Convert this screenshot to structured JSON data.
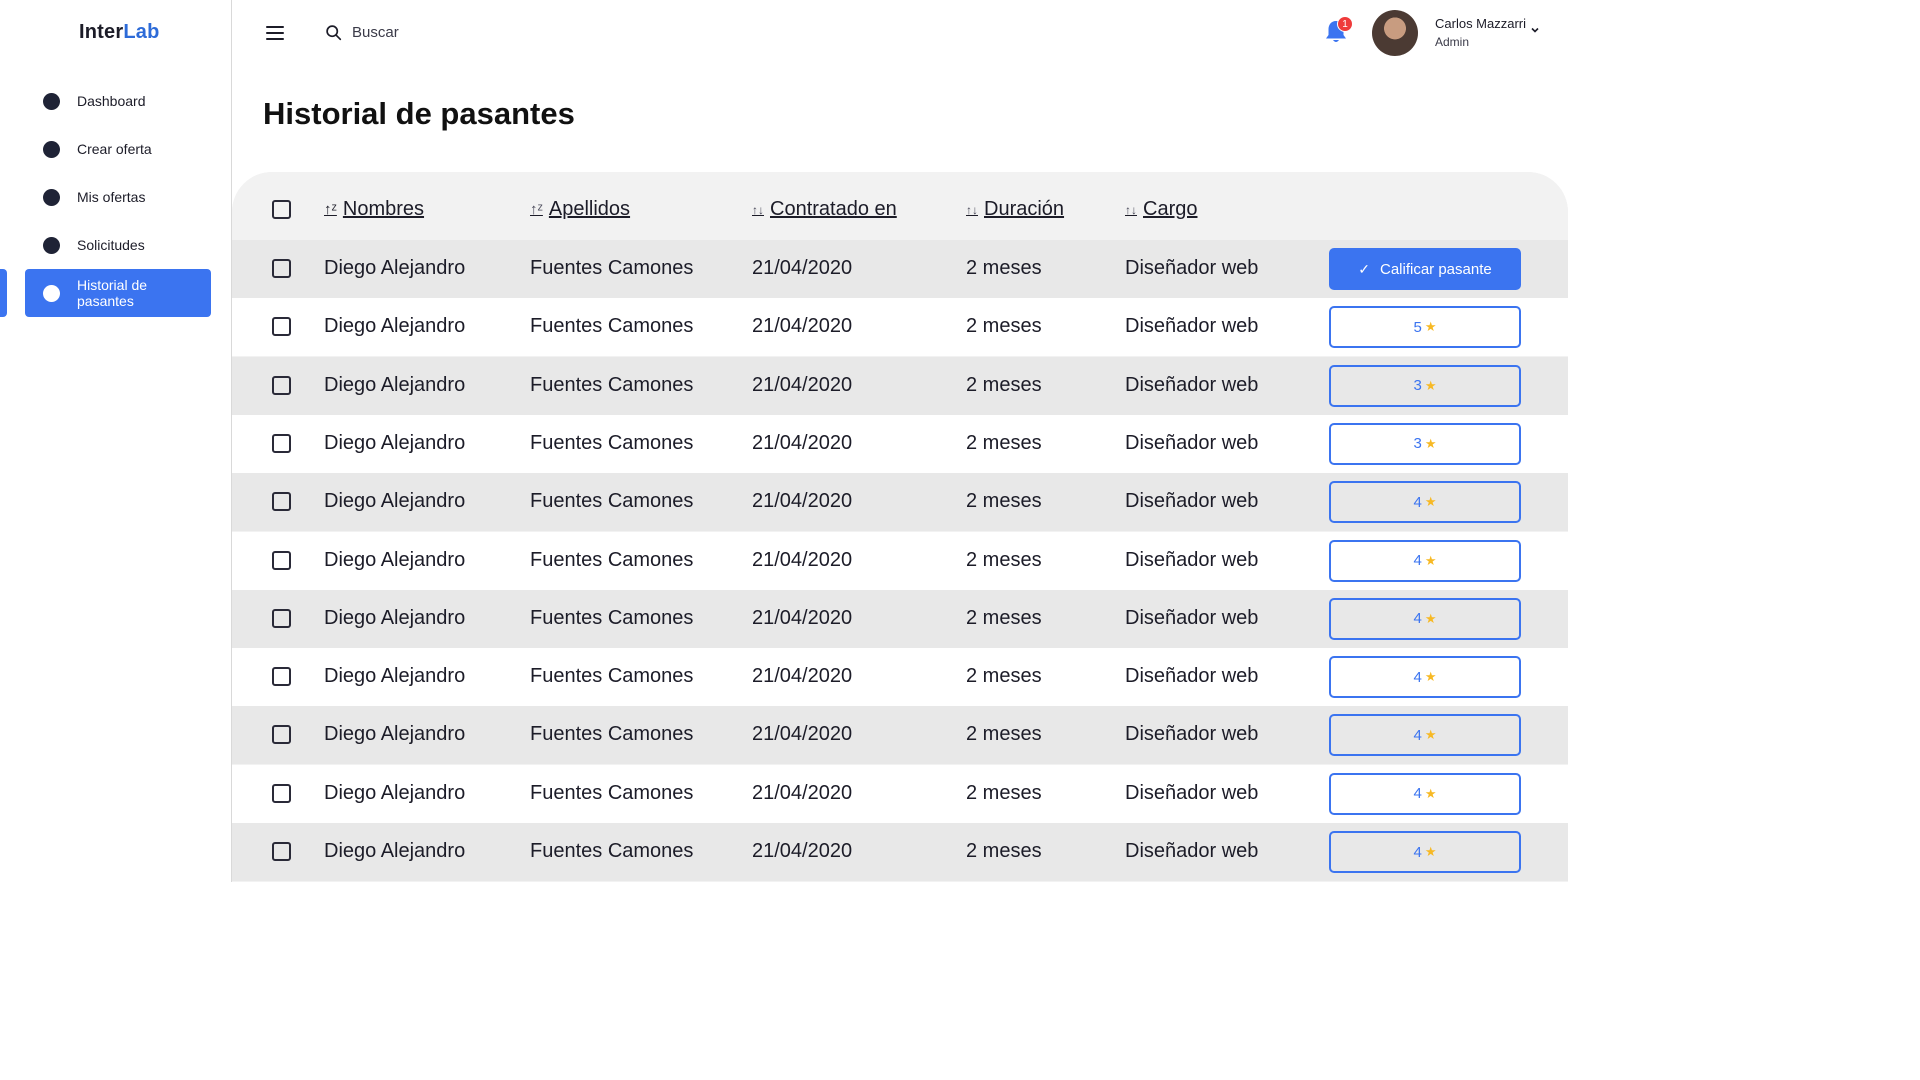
{
  "brand": {
    "name_part1": "Inter",
    "name_part2": "Lab",
    "accent": "#3b74f0"
  },
  "sidebar": {
    "items": [
      {
        "label": "Dashboard"
      },
      {
        "label": "Crear oferta"
      },
      {
        "label": "Mis ofertas"
      },
      {
        "label": "Solicitudes"
      },
      {
        "label": "Historial de pasantes",
        "active": true
      }
    ]
  },
  "topbar": {
    "search_placeholder": "Buscar",
    "notifications_count": "1",
    "user": {
      "name": "Carlos Mazzarri",
      "role": "Admin"
    }
  },
  "page": {
    "title": "Historial de pasantes"
  },
  "table": {
    "columns": [
      "Nombres",
      "Apellidos",
      "Contratado en",
      "Duración",
      "Cargo"
    ],
    "rate_label": "Calificar pasante",
    "rows": [
      {
        "nombres": "Diego Alejandro",
        "apellidos": "Fuentes Camones",
        "contratado": "21/04/2020",
        "duracion": "2 meses",
        "cargo": "Diseñador web",
        "rating": null
      },
      {
        "nombres": "Diego Alejandro",
        "apellidos": "Fuentes Camones",
        "contratado": "21/04/2020",
        "duracion": "2 meses",
        "cargo": "Diseñador web",
        "rating": "5"
      },
      {
        "nombres": "Diego Alejandro",
        "apellidos": "Fuentes Camones",
        "contratado": "21/04/2020",
        "duracion": "2 meses",
        "cargo": "Diseñador web",
        "rating": "3"
      },
      {
        "nombres": "Diego Alejandro",
        "apellidos": "Fuentes Camones",
        "contratado": "21/04/2020",
        "duracion": "2 meses",
        "cargo": "Diseñador web",
        "rating": "3"
      },
      {
        "nombres": "Diego Alejandro",
        "apellidos": "Fuentes Camones",
        "contratado": "21/04/2020",
        "duracion": "2 meses",
        "cargo": "Diseñador web",
        "rating": "4"
      },
      {
        "nombres": "Diego Alejandro",
        "apellidos": "Fuentes Camones",
        "contratado": "21/04/2020",
        "duracion": "2 meses",
        "cargo": "Diseñador web",
        "rating": "4"
      },
      {
        "nombres": "Diego Alejandro",
        "apellidos": "Fuentes Camones",
        "contratado": "21/04/2020",
        "duracion": "2 meses",
        "cargo": "Diseñador web",
        "rating": "4"
      },
      {
        "nombres": "Diego Alejandro",
        "apellidos": "Fuentes Camones",
        "contratado": "21/04/2020",
        "duracion": "2 meses",
        "cargo": "Diseñador web",
        "rating": "4"
      },
      {
        "nombres": "Diego Alejandro",
        "apellidos": "Fuentes Camones",
        "contratado": "21/04/2020",
        "duracion": "2 meses",
        "cargo": "Diseñador web",
        "rating": "4"
      },
      {
        "nombres": "Diego Alejandro",
        "apellidos": "Fuentes Camones",
        "contratado": "21/04/2020",
        "duracion": "2 meses",
        "cargo": "Diseñador web",
        "rating": "4"
      },
      {
        "nombres": "Diego Alejandro",
        "apellidos": "Fuentes Camones",
        "contratado": "21/04/2020",
        "duracion": "2 meses",
        "cargo": "Diseñador web",
        "rating": "4"
      }
    ]
  }
}
